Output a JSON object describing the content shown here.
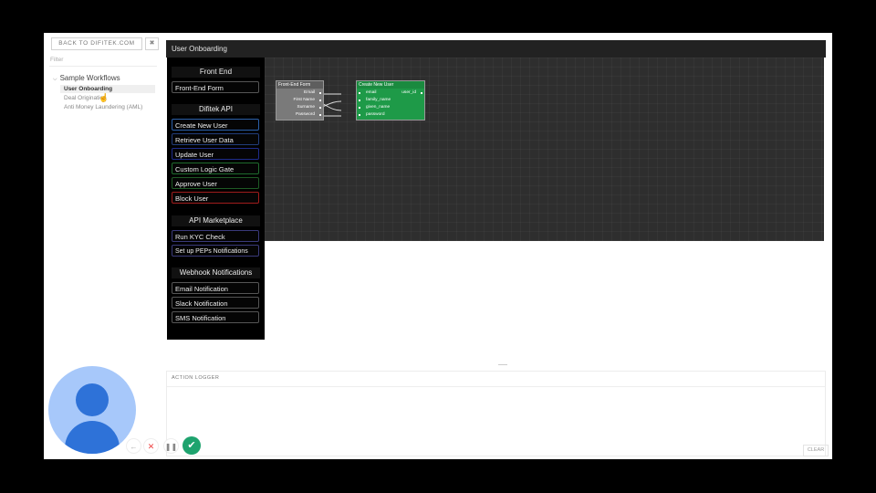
{
  "sidebar": {
    "back_button": "BACK TO DIFITEK.COM",
    "pin_icon": "pin-icon",
    "filter_placeholder": "Filter",
    "tree": {
      "root_label": "Sample Workflows",
      "items": [
        {
          "label": "User Onboarding"
        },
        {
          "label": "Deal Origination"
        },
        {
          "label": "Anti Money Laundering (AML)"
        }
      ]
    }
  },
  "main": {
    "title": "User Onboarding",
    "palette": {
      "sections": [
        {
          "title": "Front End",
          "items": [
            {
              "label": "Front-End Form"
            }
          ]
        },
        {
          "title": "Difitek API",
          "items": [
            {
              "label": "Create New User"
            },
            {
              "label": "Retrieve User Data"
            },
            {
              "label": "Update User"
            },
            {
              "label": "Custom Logic Gate"
            },
            {
              "label": "Approve User"
            },
            {
              "label": "Block User"
            }
          ]
        },
        {
          "title": "API Marketplace",
          "items": [
            {
              "label": "Run KYC Check"
            },
            {
              "label": "Set up PEPs Notifications"
            }
          ]
        },
        {
          "title": "Webhook Notifications",
          "items": [
            {
              "label": "Email Notification"
            },
            {
              "label": "Slack Notification"
            },
            {
              "label": "SMS Notification"
            }
          ]
        }
      ]
    },
    "canvas": {
      "node_front_end": {
        "title": "Front-End Form",
        "ports": [
          "Email",
          "First Name",
          "Surname",
          "Password"
        ]
      },
      "node_create_user": {
        "title": "Create New User",
        "inputs": [
          "email",
          "family_name",
          "given_name",
          "password"
        ],
        "output": "user_id"
      }
    }
  },
  "logger": {
    "label": "ACTION LOGGER",
    "clear_label": "CLEAR"
  },
  "colors": {
    "canvas_bg": "#2e2e2e",
    "node_front_end": "#7a7a7a",
    "node_create_user": "#1e9a48",
    "accept_button": "#1ea36e",
    "avatar_bg": "#a7c8fa",
    "avatar_fg": "#2e72d8"
  },
  "controls": {
    "back": "arrow-left-icon",
    "cancel": "close-icon",
    "pause": "pause-icon",
    "accept": "check-icon"
  }
}
